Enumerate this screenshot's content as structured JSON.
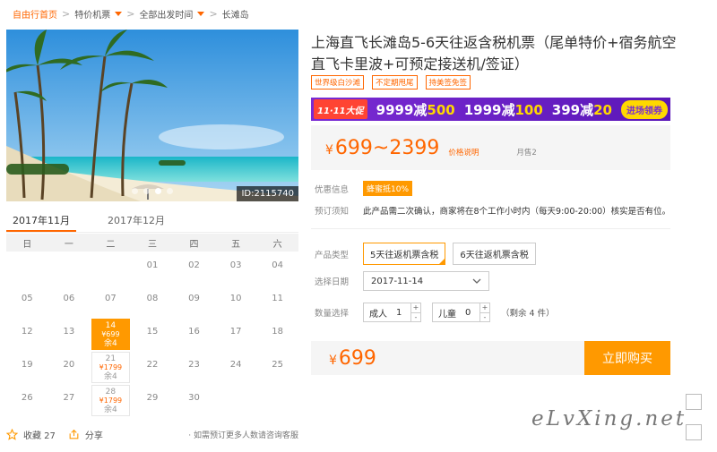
{
  "breadcrumb": {
    "home": "自由行首页",
    "category": "特价机票",
    "departure": "全部出发时间",
    "current": "长滩岛"
  },
  "hero": {
    "id_label": "ID:2115740"
  },
  "calendar": {
    "months": [
      "2017年11月",
      "2017年12月"
    ],
    "weekdays": [
      "日",
      "一",
      "二",
      "三",
      "四",
      "五",
      "六"
    ],
    "row1": [
      "",
      "",
      "",
      "01",
      "02",
      "03",
      "04"
    ],
    "row2": [
      "05",
      "06",
      "07",
      "08",
      "09",
      "10",
      "11"
    ],
    "row3": [
      "12",
      "13",
      "14",
      "15",
      "16",
      "17",
      "18"
    ],
    "row4": [
      "19",
      "20",
      "21",
      "22",
      "23",
      "24",
      "25"
    ],
    "row5": [
      "26",
      "27",
      "28",
      "29",
      "30",
      "",
      ""
    ],
    "day14": {
      "day": "14",
      "price": "¥699",
      "stock": "余4"
    },
    "day21": {
      "day": "21",
      "price": "¥1799",
      "stock": "余4"
    },
    "day28": {
      "day": "28",
      "price": "¥1799",
      "stock": "余4"
    }
  },
  "actions": {
    "favorite": "收藏 27",
    "share": "分享",
    "note": "· 如需预订更多人数请咨询客服"
  },
  "product": {
    "title": "上海直飞长滩岛5-6天往返含税机票（尾单特价+宿务航空直飞卡里波+可预定接送机/签证）",
    "tags": [
      "世界级白沙滩",
      "不定期甩尾",
      "持美签免签"
    ]
  },
  "promo": {
    "badge": "11·11大促",
    "deals": [
      {
        "a": "9999减",
        "b": "500"
      },
      {
        "a": "1999减",
        "b": "100"
      },
      {
        "a": "399减",
        "b": "20"
      }
    ],
    "button": "进场领券"
  },
  "price": {
    "currency": "¥",
    "range": "699~2399",
    "desc": "价格说明",
    "sold": "月售2"
  },
  "info": {
    "discount_label": "优惠信息",
    "discount_value": "蜂蜜抵10%",
    "notice_label": "预订须知",
    "notice_value": "此产品需二次确认，商家将在8个工作小时内（每天9:00-20:00）核实是否有位。"
  },
  "options": {
    "type_label": "产品类型",
    "types": [
      "5天往返机票含税",
      "6天往返机票含税"
    ],
    "date_label": "选择日期",
    "date_value": "2017-11-14",
    "qty_label": "数量选择",
    "adult_label": "成人",
    "adult_value": "1",
    "child_label": "儿童",
    "child_value": "0",
    "remain": "（剩余 4 件）"
  },
  "buy": {
    "currency": "¥",
    "total": "699",
    "button": "立即购买"
  },
  "watermark": "eLvXing.net"
}
